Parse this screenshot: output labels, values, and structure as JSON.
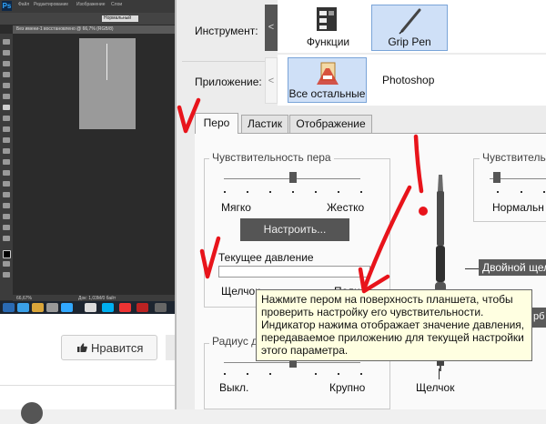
{
  "photoshop": {
    "menus": [
      "Файл",
      "Редактирование",
      "Изображение",
      "Слои"
    ],
    "mode_value": "Нормальный",
    "doc_tab": "Без имени-1 восстановлено @ 66,7% (RGB/8)",
    "zoom": "66,67%",
    "status": "Док: 1,03М/0 байт"
  },
  "webpage": {
    "like_label": "Нравится"
  },
  "dialog": {
    "tool_label": "Инструмент:",
    "app_label": "Приложение:",
    "tools": [
      "Функции",
      "Grip Pen"
    ],
    "apps": [
      "Все остальные",
      "Photoshop"
    ],
    "tabs": [
      "Перо",
      "Ластик",
      "Отображение"
    ],
    "pressure": {
      "title": "Чувствительность пера",
      "soft": "Мягко",
      "firm": "Жестко",
      "configure_button": "Настроить...",
      "current_title": "Текущее давление",
      "click": "Щелчок",
      "max": "Полное"
    },
    "tilt": {
      "title": "Чувствительн",
      "normal": "Нормальн"
    },
    "radius": {
      "title": "Радиус д",
      "off": "Выкл.",
      "large": "Крупно"
    },
    "pen": {
      "double_click": "Двойной щелчок",
      "click": "Щелчок",
      "side_partial": "рб"
    },
    "tooltip": [
      "Нажмите пером на поверхность планшета, чтобы",
      "проверить настройку его чувствительности.",
      "Индикатор нажима отображает значение давления,",
      "передаваемое приложению для текущей настройки",
      "этого параметра."
    ]
  },
  "colors": {
    "annotation": "#e8141b",
    "selected_tile": "#cfe0f7",
    "dark_button": "#555555"
  }
}
